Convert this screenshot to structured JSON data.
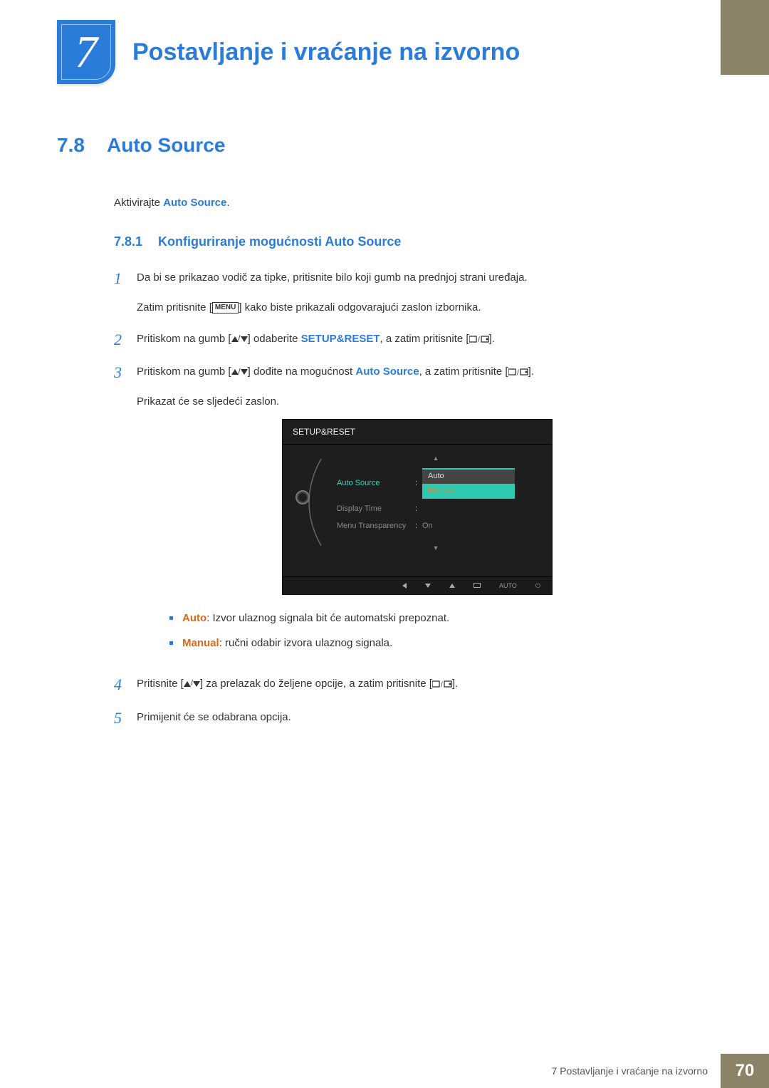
{
  "header": {
    "chapter_number": "7",
    "chapter_title": "Postavljanje i vraćanje na izvorno"
  },
  "section": {
    "number": "7.8",
    "title": "Auto Source"
  },
  "intro": {
    "prefix": "Aktivirajte ",
    "highlight": "Auto Source",
    "suffix": "."
  },
  "subsection": {
    "number": "7.8.1",
    "title": "Konfiguriranje mogućnosti Auto Source"
  },
  "menu_label": "MENU",
  "steps": {
    "s1": {
      "num": "1",
      "line1": "Da bi se prikazao vodič za tipke, pritisnite bilo koji gumb na prednjoj strani uređaja.",
      "line2a": "Zatim pritisnite [",
      "line2b": "] kako biste prikazali odgovarajući zaslon izbornika."
    },
    "s2": {
      "num": "2",
      "a": "Pritiskom na gumb [",
      "b": "] odaberite ",
      "target": "SETUP&RESET",
      "c": ", a zatim pritisnite [",
      "d": "]."
    },
    "s3": {
      "num": "3",
      "a": "Pritiskom na gumb [",
      "b": "] dođite na mogućnost ",
      "target": "Auto Source",
      "c": ", a zatim pritisnite [",
      "d": "].",
      "line2": "Prikazat će se sljedeći zaslon."
    },
    "s4": {
      "num": "4",
      "a": "Pritisnite [",
      "b": "] za prelazak do željene opcije, a zatim pritisnite [",
      "c": "]."
    },
    "s5": {
      "num": "5",
      "text": "Primijenit će se odabrana opcija."
    }
  },
  "osd": {
    "title": "SETUP&RESET",
    "rows": {
      "auto_source": "Auto Source",
      "display_time": "Display Time",
      "menu_transparency": "Menu Transparency"
    },
    "dropdown": {
      "auto": "Auto",
      "manual": "Manual"
    },
    "val_on": "On",
    "footer_auto": "AUTO"
  },
  "bullets": {
    "auto_label": "Auto",
    "auto_text": ": Izvor ulaznog signala bit će automatski prepoznat.",
    "manual_label": "Manual",
    "manual_text": ": ručni odabir izvora ulaznog signala."
  },
  "footer": {
    "text": "7 Postavljanje i vraćanje na izvorno",
    "page": "70"
  }
}
